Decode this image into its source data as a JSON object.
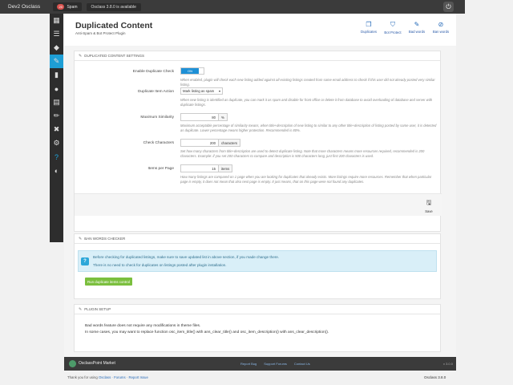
{
  "topbar": {
    "brand": "Dev2 Osclass",
    "spam_count": "20",
    "spam_label": "Spam",
    "update_notice": "Osclass 3.8.0 is available"
  },
  "header": {
    "title": "Duplicated Content",
    "subtitle": "Anti-Spam & Bot Protect Plugin",
    "tabs": [
      {
        "label": "Duplicates",
        "icon": "copy-icon"
      },
      {
        "label": "Bot Protect",
        "icon": "shield-icon"
      },
      {
        "label": "Bad words",
        "icon": "pencil-icon"
      },
      {
        "label": "Ban words",
        "icon": "ban-icon"
      }
    ]
  },
  "settings": {
    "heading": "Duplicated content settings",
    "enable": {
      "label": "Enable Duplicate Check",
      "value": "ON",
      "help": "When enabled, plugin will check each new listing added against all existing listings created from same email address to check if this user did not already posted very similar listing."
    },
    "action": {
      "label": "Duplicate Item Action",
      "value": "Mark listing as spam",
      "help": "When new listing is identified as duplicate, you can mark it as spam and disable for front office or delete it from database to avoid overloading of database and server with duplicate listings."
    },
    "similarity": {
      "label": "Maximum Similarity",
      "value": "80",
      "unit": "%",
      "help": "Maximum acceptable percentage of similarity means, when title+description of new listing to similar to any other title+description of listing posted by same user, it is detected as duplicate. Lower percentage means higher protection. Recommended is 80%."
    },
    "characters": {
      "label": "Check Characters",
      "value": "200",
      "unit": "characters",
      "help": "Set how many characters from title+description are used to detect duplicate listing. Note that more characters means more resources required, recommended is 200 characters. Example: if you set 200 characters to compare and description is 500 characters long, just first 200 characters is used."
    },
    "per_page": {
      "label": "Items per Page",
      "value": "15",
      "unit": "items",
      "help": "How many listings are compared on 1 page when you are looking for duplicates that already exists. More listings require more resources. Remember that when particular page is empty, it does not mean that also next page is empty. It just means, that on this page were not found any duplicates."
    },
    "save_label": "Save"
  },
  "ban_checker": {
    "heading": "Ban words checker",
    "info_line1": "Before checking for duplicated listings, make sure to save updated list in above section, if you made change there.",
    "info_line2": "There is no need to check for duplicates on listings posted after plugin installation.",
    "run_label": "Run duplicate items control"
  },
  "plugin_setup": {
    "heading": "Plugin setup",
    "line1": "Bad words feature does not require any modifications in theme files.",
    "line2": "In some cases, you may want to replace function osc_item_title() with ans_clear_title() and osc_item_description() with ans_clear_description()."
  },
  "footer": {
    "market": "OsclassPoint Market",
    "links": [
      "Report Bug",
      "Support Forums",
      "Contact Us"
    ],
    "version": "v 3.0.0"
  },
  "bottom": {
    "thanks": "Thank you for using",
    "osclass_link": "Osclass",
    "forums_link": "Forums",
    "report_link": "Report Issue",
    "version": "Osclass 3.8.0"
  }
}
